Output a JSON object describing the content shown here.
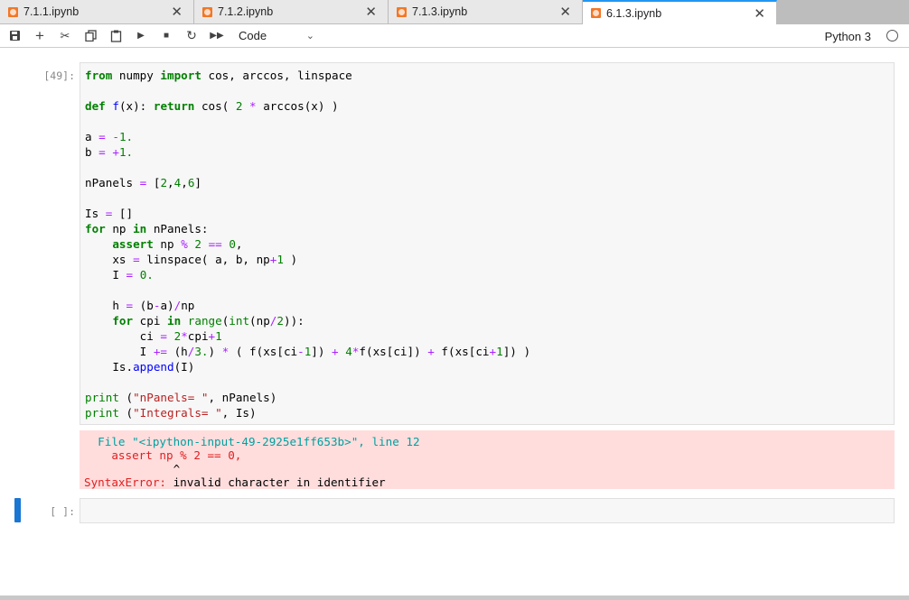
{
  "tabs": [
    {
      "label": "7.1.1.ipynb",
      "active": false
    },
    {
      "label": "7.1.2.ipynb",
      "active": false
    },
    {
      "label": "7.1.3.ipynb",
      "active": false
    },
    {
      "label": "6.1.3.ipynb",
      "active": true
    }
  ],
  "toolbar": {
    "buttons": [
      "save-icon",
      "add-cell-icon",
      "cut-icon",
      "copy-icon",
      "paste-icon",
      "run-icon",
      "stop-icon",
      "restart-icon",
      "fast-forward-icon"
    ],
    "cell_type": "Code",
    "kernel": "Python 3"
  },
  "cells": [
    {
      "prompt": "[49]:",
      "error": {
        "file_line": "  File \"<ipython-input-49-2925e1ff653b>\", line 12",
        "source_line": "    assert np % 2 == 0,",
        "caret_line": "             ^",
        "error_name": "SyntaxError:",
        "error_msg": " invalid character in identifier"
      }
    },
    {
      "prompt": "[ ]:"
    }
  ],
  "colors": {
    "accent": "#2196f3",
    "error_bg": "#ffdddd",
    "tab_icon": "#f37726"
  }
}
